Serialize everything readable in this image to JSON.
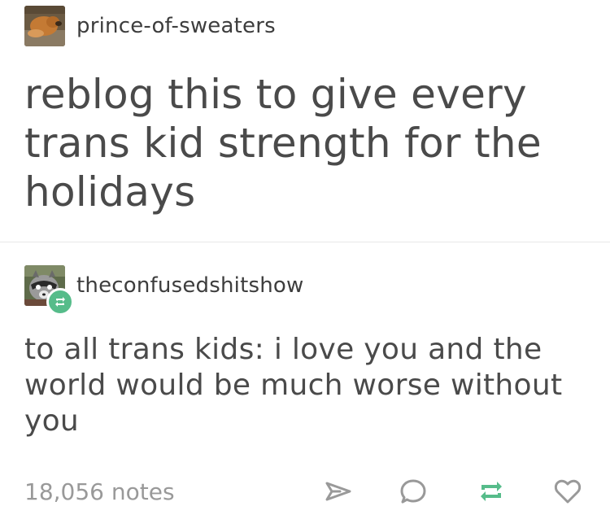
{
  "original_post": {
    "username": "prince-of-sweaters",
    "avatar_icon": "dog-avatar",
    "text": "reblog this to give every trans kid strength for the holidays"
  },
  "reblog": {
    "username": "theconfusedshitshow",
    "avatar_icon": "raccoon-avatar",
    "badge_icon": "reblog-badge-icon",
    "text": "to all trans kids: i love you and the world would be much worse without you"
  },
  "footer": {
    "notes": "18,056 notes",
    "actions": [
      "share-icon",
      "reply-icon",
      "reblog-icon",
      "like-icon"
    ]
  },
  "colors": {
    "text": "#4a4a4a",
    "muted": "#999999",
    "reblog_green": "#56bc8a",
    "divider": "#e8e8e8"
  }
}
